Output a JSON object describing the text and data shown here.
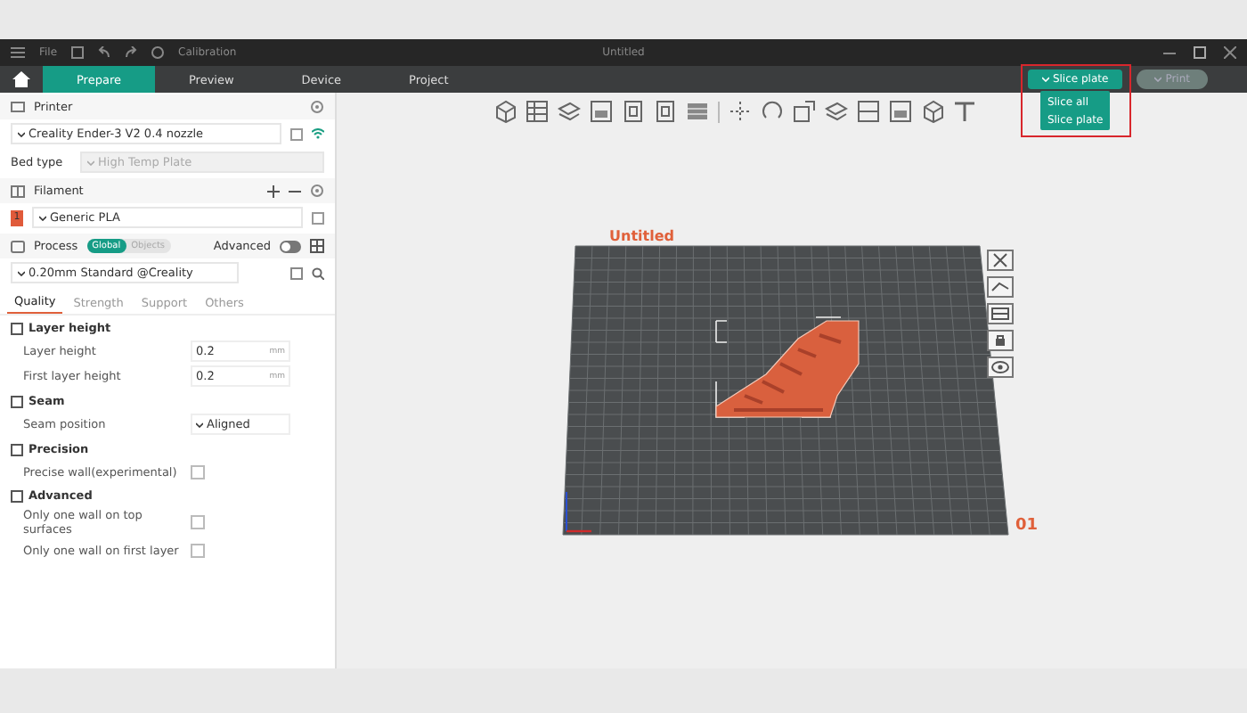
{
  "titlebar": {
    "menu": "File",
    "calibration": "Calibration",
    "title": "Untitled"
  },
  "tabs": [
    {
      "label": "Prepare",
      "selected": true
    },
    {
      "label": "Preview",
      "selected": false
    },
    {
      "label": "Device",
      "selected": false
    },
    {
      "label": "Project",
      "selected": false
    }
  ],
  "slice": {
    "button": "Slice plate",
    "menu": [
      "Slice all",
      "Slice plate"
    ],
    "print": "Print",
    "print_disabled": true
  },
  "printer": {
    "header": "Printer",
    "preset": "Creality Ender-3 V2 0.4 nozzle",
    "bed_label": "Bed type",
    "bed_value": "High Temp Plate"
  },
  "filament": {
    "header": "Filament",
    "items": [
      {
        "index": "1",
        "name": "Generic PLA",
        "color": "#e05a3a"
      }
    ]
  },
  "process": {
    "header": "Process",
    "scopes": [
      {
        "label": "Global",
        "selected": true
      },
      {
        "label": "Objects",
        "selected": false
      }
    ],
    "advanced_label": "Advanced",
    "advanced_on": false,
    "preset": "0.20mm Standard @Creality"
  },
  "subtabs": [
    {
      "label": "Quality",
      "selected": true
    },
    {
      "label": "Strength",
      "selected": false
    },
    {
      "label": "Support",
      "selected": false
    },
    {
      "label": "Others",
      "selected": false
    }
  ],
  "groups": [
    {
      "title": "Layer height",
      "rows": [
        {
          "kind": "number",
          "label": "Layer height",
          "value": "0.2",
          "unit": "mm"
        },
        {
          "kind": "number",
          "label": "First layer height",
          "value": "0.2",
          "unit": "mm"
        }
      ]
    },
    {
      "title": "Seam",
      "rows": [
        {
          "kind": "select",
          "label": "Seam position",
          "value": "Aligned"
        }
      ]
    },
    {
      "title": "Precision",
      "rows": [
        {
          "kind": "check",
          "label": "Precise wall(experimental)",
          "checked": false
        }
      ]
    },
    {
      "title": "Advanced",
      "rows": [
        {
          "kind": "check",
          "label": "Only one wall on top surfaces",
          "checked": false
        },
        {
          "kind": "check",
          "label": "Only one wall on first layer",
          "checked": false
        }
      ]
    }
  ],
  "plate": {
    "name": "Untitled",
    "number": "01"
  }
}
